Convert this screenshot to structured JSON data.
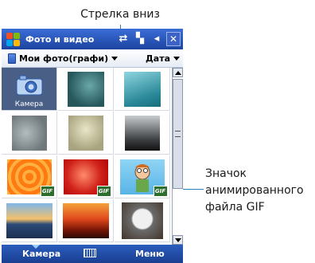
{
  "annotations": {
    "dropdown_arrow": "Стрелка вниз",
    "gif_icon_lines": [
      "Значок",
      "анимированного",
      "файла GIF"
    ]
  },
  "titlebar": {
    "app_title": "Фото и видео",
    "icons": [
      "windows-start-icon",
      "connectivity-icon",
      "signal-icon",
      "volume-icon",
      "close-icon"
    ]
  },
  "toolbar": {
    "folder_label": "Мои фото(графи)",
    "sort_label": "Дата"
  },
  "grid": {
    "camera_label": "Камера",
    "gif_badge": "GIF",
    "items": [
      {
        "name": "camera",
        "selected": true
      },
      {
        "name": "photo-teal-texture"
      },
      {
        "name": "photo-teal-gradient"
      },
      {
        "name": "photo-gray-texture"
      },
      {
        "name": "photo-beige-texture"
      },
      {
        "name": "photo-dark-gradient"
      },
      {
        "name": "gif-orange-circles",
        "gif": true
      },
      {
        "name": "gif-red-heart",
        "gif": true
      },
      {
        "name": "gif-cartoon-character",
        "gif": true
      },
      {
        "name": "photo-lake-sunset"
      },
      {
        "name": "photo-red-sunset"
      },
      {
        "name": "photo-husky-dog"
      }
    ]
  },
  "softbar": {
    "left": "Камера",
    "right": "Меню"
  },
  "colors": {
    "accent": "#1f5fa6",
    "title_bar": "#2a56b8",
    "selected_cell": "#4a5f86"
  }
}
